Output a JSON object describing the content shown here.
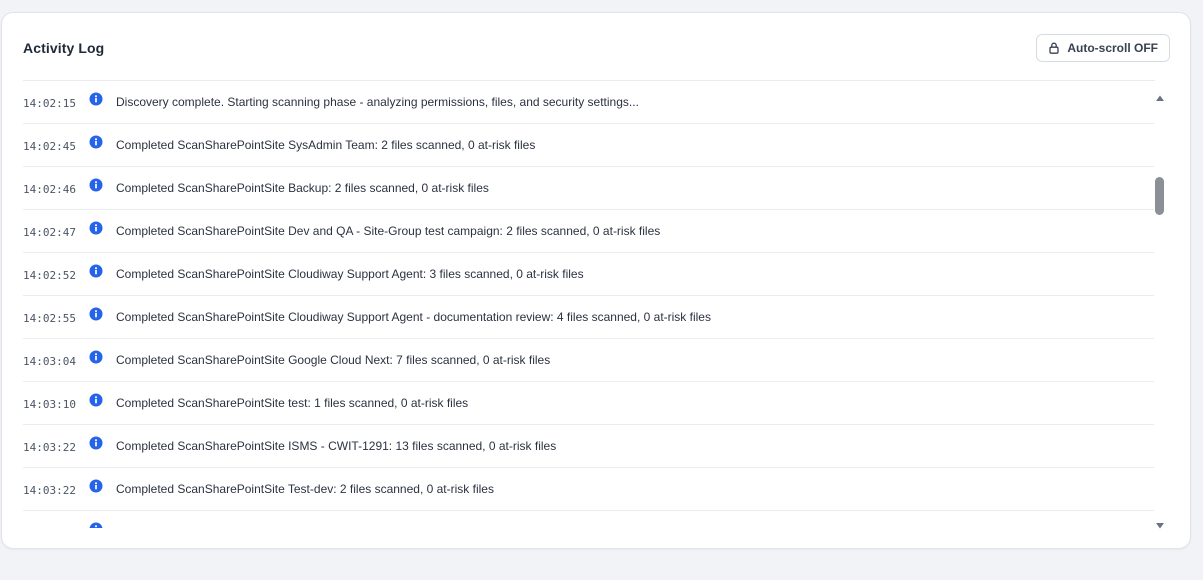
{
  "panel": {
    "title": "Activity Log",
    "autoscroll_label": "Auto-scroll OFF",
    "autoscroll_icon": "lock-icon"
  },
  "colors": {
    "accent": "#2563eb",
    "background": "#f1f3f7",
    "card": "#ffffff"
  },
  "log": {
    "entries": [
      {
        "time": "14:02:15",
        "level_icon": "info-icon",
        "message": "Discovery complete. Starting scanning phase - analyzing permissions, files, and security settings..."
      },
      {
        "time": "14:02:45",
        "level_icon": "info-icon",
        "message": "Completed ScanSharePointSite SysAdmin Team: 2 files scanned, 0 at-risk files"
      },
      {
        "time": "14:02:46",
        "level_icon": "info-icon",
        "message": "Completed ScanSharePointSite Backup: 2 files scanned, 0 at-risk files"
      },
      {
        "time": "14:02:47",
        "level_icon": "info-icon",
        "message": "Completed ScanSharePointSite Dev and QA - Site-Group test campaign: 2 files scanned, 0 at-risk files"
      },
      {
        "time": "14:02:52",
        "level_icon": "info-icon",
        "message": "Completed ScanSharePointSite Cloudiway Support Agent: 3 files scanned, 0 at-risk files"
      },
      {
        "time": "14:02:55",
        "level_icon": "info-icon",
        "message": "Completed ScanSharePointSite Cloudiway Support Agent - documentation review: 4 files scanned, 0 at-risk files"
      },
      {
        "time": "14:03:04",
        "level_icon": "info-icon",
        "message": "Completed ScanSharePointSite Google Cloud Next: 7 files scanned, 0 at-risk files"
      },
      {
        "time": "14:03:10",
        "level_icon": "info-icon",
        "message": "Completed ScanSharePointSite test: 1 files scanned, 0 at-risk files"
      },
      {
        "time": "14:03:22",
        "level_icon": "info-icon",
        "message": "Completed ScanSharePointSite ISMS - CWIT-1291: 13 files scanned, 0 at-risk files"
      },
      {
        "time": "14:03:22",
        "level_icon": "info-icon",
        "message": "Completed ScanSharePointSite Test-dev: 2 files scanned, 0 at-risk files"
      },
      {
        "time": "",
        "level_icon": "info-icon",
        "message": ""
      }
    ]
  },
  "scrollbar": {
    "up_icon": "chevron-up-icon",
    "down_icon": "chevron-down-icon"
  }
}
